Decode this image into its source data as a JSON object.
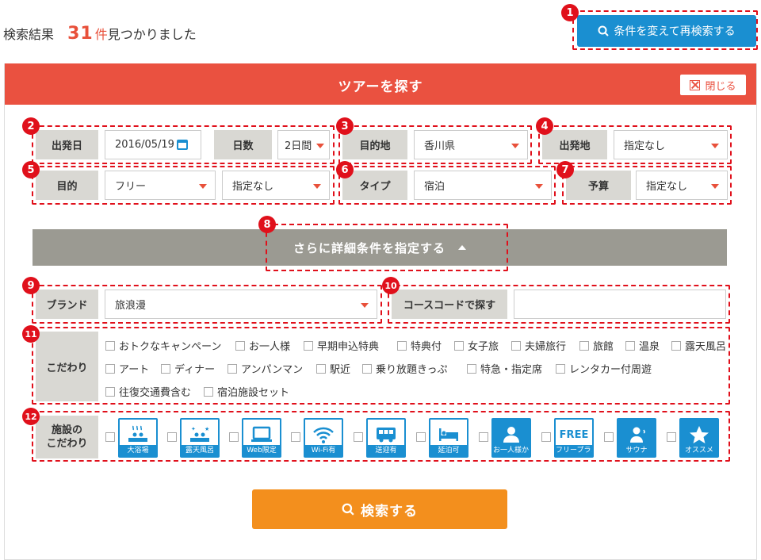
{
  "header": {
    "result_prefix": "検索結果",
    "result_count": "31",
    "result_unit": "件",
    "result_suffix": "見つかりました",
    "research_button": "条件を変えて再検索する"
  },
  "panel": {
    "title": "ツアーを探す",
    "close_label": "閉じる"
  },
  "badges": [
    "1",
    "2",
    "3",
    "4",
    "5",
    "6",
    "7",
    "8",
    "9",
    "10",
    "11",
    "12"
  ],
  "fields": {
    "departure_date_label": "出発日",
    "departure_date_value": "2016/05/19",
    "days_label": "日数",
    "days_value": "2日間",
    "destination_label": "目的地",
    "destination_value": "香川県",
    "origin_label": "出発地",
    "origin_value": "指定なし",
    "purpose_label": "目的",
    "purpose_value": "フリー",
    "purpose_sub_value": "指定なし",
    "type_label": "タイプ",
    "type_value": "宿泊",
    "budget_label": "予算",
    "budget_value": "指定なし"
  },
  "more_button": "さらに詳細条件を指定する",
  "brand": {
    "label": "ブランド",
    "value": "旅浪漫",
    "course_code_label": "コースコードで探す",
    "course_code_value": ""
  },
  "kodawari": {
    "label": "こだわり",
    "rows": [
      [
        "おトクなキャンペーン",
        "お一人様",
        "早期申込特典",
        "特典付",
        "女子旅",
        "夫婦旅行",
        "旅館",
        "温泉",
        "露天風呂"
      ],
      [
        "アート",
        "ディナー",
        "アンパンマン",
        "駅近",
        "乗り放題きっぷ",
        "特急・指定席",
        "レンタカー付周遊"
      ],
      [
        "往復交通費含む",
        "宿泊施設セット"
      ]
    ]
  },
  "facility": {
    "label_line1": "施設の",
    "label_line2": "こだわり",
    "items": [
      {
        "icon": "large-bath-icon",
        "caption": "大浴場"
      },
      {
        "icon": "open-air-bath-icon",
        "caption": "露天風呂"
      },
      {
        "icon": "laptop-icon",
        "caption": "Web限定"
      },
      {
        "icon": "wifi-icon",
        "caption": "Wi-Fi有"
      },
      {
        "icon": "bus-icon",
        "caption": "送迎有"
      },
      {
        "icon": "bed-icon",
        "caption": "延泊可"
      },
      {
        "icon": "single-person-icon",
        "caption": "お一人様から可"
      },
      {
        "icon": "free-plan-icon",
        "caption": "フリープラン",
        "text": "FREE"
      },
      {
        "icon": "sauna-icon",
        "caption": "サウナ"
      },
      {
        "icon": "star-icon",
        "caption": "オススメ"
      }
    ]
  },
  "search_button": "検索する",
  "colors": {
    "accent_red": "#ea5140",
    "highlight_red": "#e0101b",
    "blue": "#1a8fd1",
    "orange": "#f38f1d",
    "label_gray": "#d9d8d3",
    "more_gray": "#9b9a92"
  }
}
